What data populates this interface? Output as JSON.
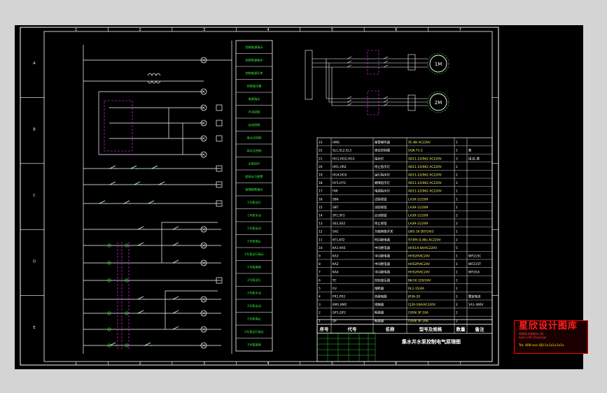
{
  "title_block": {
    "name": "集水井水泵控制电气原理图",
    "header": [
      "序号",
      "代号",
      "名称",
      "型号及规格",
      "数量",
      "备注"
    ]
  },
  "watermark": {
    "title": "星欣设计图库",
    "sub1": "WWW.XINEDU.CN",
    "sub2": "Auto CAD Drawings",
    "contact": "Tel: 400-xxx QQ:1x1x1x1x1x"
  },
  "border_numbers": {
    "top": [
      "1",
      "2",
      "3",
      "4",
      "5",
      "6",
      "7"
    ],
    "left": [
      "A",
      "B",
      "C",
      "D",
      "E"
    ]
  },
  "function_boxes": [
    "控制电源指示",
    "控制电源保护",
    "控制电源开关",
    "控制变压器",
    "电源指示",
    "手动控制",
    "自动控制",
    "低水位控制",
    "高水位控制",
    "水泵运行",
    "超高水位报警",
    "故障报警指示",
    "1号泵运行",
    "1号泵手动",
    "1号泵自动",
    "1号泵停止",
    "1号泵运行指示",
    "1号泵故障",
    "2号泵运行",
    "2号泵手动",
    "2号泵自动",
    "2号泵停止",
    "2号泵运行指示",
    "2号泵故障"
  ],
  "pump_labels": [
    "1M",
    "2M"
  ],
  "parts": [
    [
      "23",
      "HMS",
      "报警蜂鸣器",
      "XC-88 AC220V",
      "1",
      ""
    ],
    [
      "22",
      "SL1,SL2,SL3",
      "液位控制器",
      "UQK-71-2",
      "1",
      "套"
    ],
    [
      "21",
      "HG1,HG2,HG3",
      "指示灯",
      "AD11-22/062 AC220V",
      "3",
      "绿,红,黄"
    ],
    [
      "20",
      "HR1,HR2",
      "停止指示灯",
      "AD11-22/062 AC220V",
      "2",
      ""
    ],
    [
      "19",
      "HG4,HG5",
      "运行指示灯",
      "AD11-22/062 AC220V",
      "2",
      ""
    ],
    [
      "18",
      "HY1,HY2",
      "故障指示灯",
      "AD11-22/062 AC220V",
      "2",
      ""
    ],
    [
      "17",
      "HW",
      "电源指示灯",
      "AD11-22/062 AC220V",
      "1",
      ""
    ],
    [
      "16",
      "SB6",
      "试验按钮",
      "LA39-11/209",
      "1",
      ""
    ],
    [
      "15",
      "SBT",
      "试验按钮",
      "LA39-11/209",
      "1",
      ""
    ],
    [
      "14",
      "SF1,SF2",
      "启动按钮",
      "LA39-11/209",
      "2",
      ""
    ],
    [
      "13",
      "SS1,SS2",
      "停止按钮",
      "LA39-11/209",
      "2",
      ""
    ],
    [
      "12",
      "SAC",
      "万能转换开关",
      "LW5-16 D0724/3",
      "1",
      ""
    ],
    [
      "11",
      "KT1,KT2",
      "时间继电器",
      "ST3PA D-48s AC220V",
      "2",
      ""
    ],
    [
      "10",
      "KA1 KA5",
      "中间继电器",
      "HH51X-4A/AC220V",
      "5",
      ""
    ],
    [
      "9",
      "KA3",
      "中间继电器",
      "HH52P/AC24V",
      "1",
      "WF215C"
    ],
    [
      "8",
      "KA2",
      "中间继电器",
      "HH52P/AC24V",
      "1",
      "WF215T"
    ],
    [
      "7",
      "KA4",
      "中间继电器",
      "HH52P/AC24V",
      "1",
      "WF2GA"
    ],
    [
      "6",
      "TC",
      "控制变压器",
      "BK-50 220/24V",
      "1",
      ""
    ],
    [
      "5",
      "FU",
      "熔断器",
      "RL1-15/4A",
      "1",
      ""
    ],
    [
      "4",
      "FR1,FR2",
      "热继电器",
      "JR36-20",
      "2",
      "整定电流"
    ],
    [
      "3",
      "KM1,KM2",
      "接触器",
      "CJ20-16A/AC220V",
      "2",
      "1A1-380V"
    ],
    [
      "2",
      "QF1,QF2",
      "断路器",
      "C65N 3P 10A",
      "2",
      ""
    ],
    [
      "1",
      "QF",
      "断路器",
      "C65N 3P 20A",
      "1",
      ""
    ]
  ]
}
